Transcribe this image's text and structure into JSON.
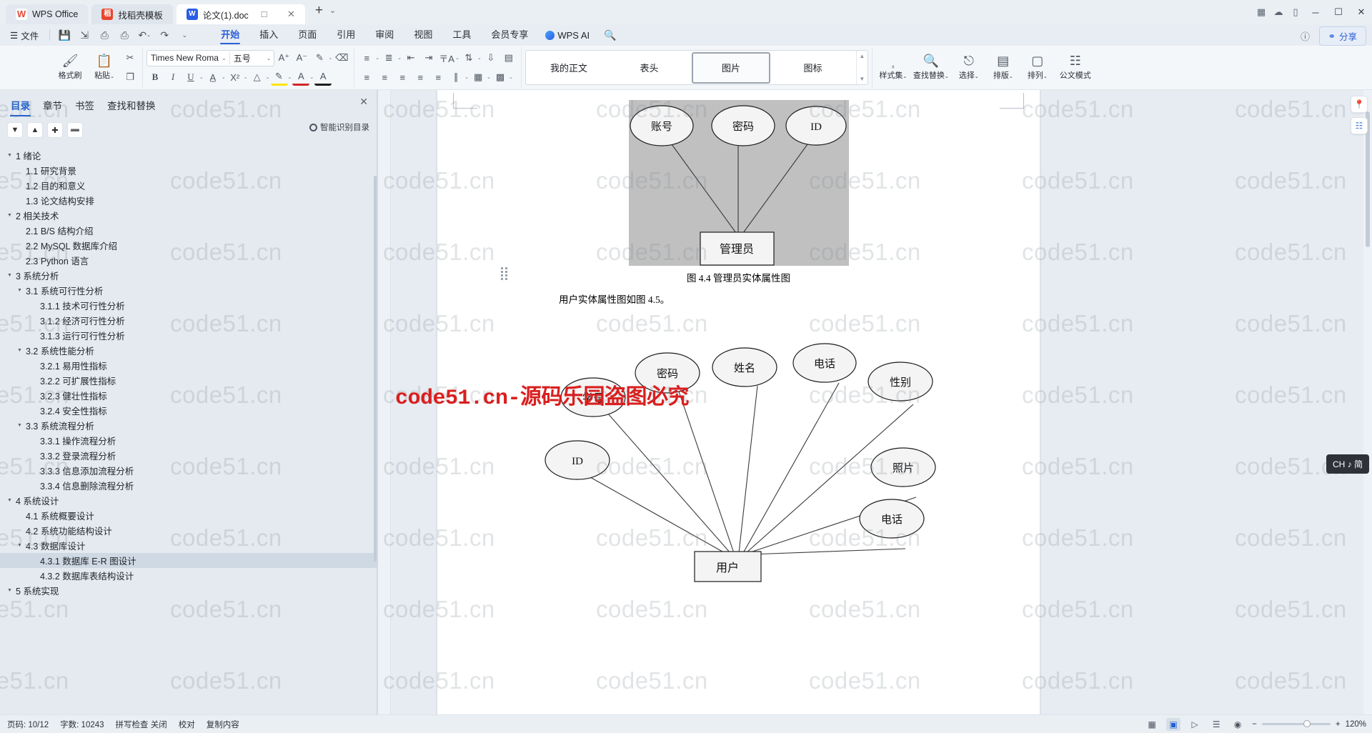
{
  "titlebar": {
    "tabs": [
      {
        "label": "WPS Office",
        "icon": "wps-logo-icon"
      },
      {
        "label": "找稻壳模板",
        "icon": "template-icon"
      },
      {
        "label": "论文(1).doc",
        "icon": "word-doc-icon"
      }
    ],
    "add_tab": "+",
    "chevron": "⌄",
    "window": {
      "minimize": "─",
      "maximize": "☐",
      "close": "✕"
    },
    "left_icons": [
      "grid-icon",
      "cloud-icon",
      "comment-icon"
    ]
  },
  "menurow": {
    "file_label": "文件",
    "quick_icons": [
      "save-icon",
      "save-as-icon",
      "print-icon",
      "print-preview-icon",
      "undo-icon",
      "redo-icon"
    ],
    "menus": [
      {
        "label": "开始",
        "active": true
      },
      {
        "label": "插入",
        "active": false
      },
      {
        "label": "页面",
        "active": false
      },
      {
        "label": "引用",
        "active": false
      },
      {
        "label": "审阅",
        "active": false
      },
      {
        "label": "视图",
        "active": false
      },
      {
        "label": "工具",
        "active": false
      },
      {
        "label": "会员专享",
        "active": false
      }
    ],
    "ai_label": "WPS AI",
    "search_icon": "search-icon",
    "share_label": "分享",
    "help_icon": "help-icon"
  },
  "ribbon": {
    "format_painter": {
      "label": "格式刷",
      "icon": "format-painter-icon"
    },
    "paste": {
      "label": "粘贴",
      "icon": "paste-icon"
    },
    "cut": {
      "icon": "scissors-icon"
    },
    "copy": {
      "icon": "copy-icon"
    },
    "font": {
      "name": "Times New Roma",
      "size": "五号"
    },
    "font_grow": "A⁺",
    "font_shrink": "A⁻",
    "styles": {
      "items": [
        {
          "label": "我的正文",
          "selected": false
        },
        {
          "label": "表头",
          "selected": false
        },
        {
          "label": "图片",
          "selected": true
        },
        {
          "label": "图标",
          "selected": false
        }
      ]
    },
    "right_buttons": [
      {
        "label": "样式集",
        "icon": "style-set-icon"
      },
      {
        "label": "查找替换",
        "icon": "find-replace-icon"
      },
      {
        "label": "选择",
        "icon": "select-icon"
      },
      {
        "label": "排版",
        "icon": "typeset-icon"
      },
      {
        "label": "排列",
        "icon": "arrange-icon"
      },
      {
        "label": "公文模式",
        "icon": "official-doc-icon"
      }
    ]
  },
  "sidebar": {
    "tabs": [
      {
        "label": "目录",
        "active": true
      },
      {
        "label": "章节",
        "active": false
      },
      {
        "label": "书签",
        "active": false
      },
      {
        "label": "查找和替换",
        "active": false
      }
    ],
    "close_icon": "close-icon",
    "tools": [
      "chevron-down-icon",
      "chevron-up-icon",
      "plus-icon",
      "minus-icon"
    ],
    "smart_toc_label": "智能识别目录",
    "toc": [
      {
        "level": 1,
        "num": "1",
        "text": "绪论",
        "expander": "▼",
        "selected": false
      },
      {
        "level": 2,
        "num": "1.1",
        "text": "研究背景",
        "expander": "",
        "selected": false
      },
      {
        "level": 2,
        "num": "1.2",
        "text": "目的和意义",
        "expander": "",
        "selected": false
      },
      {
        "level": 2,
        "num": "1.3",
        "text": "论文结构安排",
        "expander": "",
        "selected": false
      },
      {
        "level": 1,
        "num": "2",
        "text": "相关技术",
        "expander": "▼",
        "selected": false
      },
      {
        "level": 2,
        "num": "2.1",
        "text": "B/S 结构介绍",
        "expander": "",
        "selected": false
      },
      {
        "level": 2,
        "num": "2.2",
        "text": "MySQL 数据库介绍",
        "expander": "",
        "selected": false
      },
      {
        "level": 2,
        "num": "2.3",
        "text": "Python 语言",
        "expander": "",
        "selected": false
      },
      {
        "level": 1,
        "num": "3",
        "text": "系统分析",
        "expander": "▼",
        "selected": false
      },
      {
        "level": 2,
        "num": "3.1",
        "text": "系统可行性分析",
        "expander": "▼",
        "selected": false
      },
      {
        "level": 3,
        "num": "3.1.1",
        "text": "技术可行性分析",
        "expander": "",
        "selected": false
      },
      {
        "level": 3,
        "num": "3.1.2",
        "text": "经济可行性分析",
        "expander": "",
        "selected": false
      },
      {
        "level": 3,
        "num": "3.1.3",
        "text": "运行可行性分析",
        "expander": "",
        "selected": false
      },
      {
        "level": 2,
        "num": "3.2",
        "text": "系统性能分析",
        "expander": "▼",
        "selected": false
      },
      {
        "level": 3,
        "num": "3.2.1",
        "text": "易用性指标",
        "expander": "",
        "selected": false
      },
      {
        "level": 3,
        "num": "3.2.2",
        "text": "可扩展性指标",
        "expander": "",
        "selected": false
      },
      {
        "level": 3,
        "num": "3.2.3",
        "text": "健壮性指标",
        "expander": "",
        "selected": false
      },
      {
        "level": 3,
        "num": "3.2.4",
        "text": "安全性指标",
        "expander": "",
        "selected": false
      },
      {
        "level": 2,
        "num": "3.3",
        "text": "系统流程分析",
        "expander": "▼",
        "selected": false
      },
      {
        "level": 3,
        "num": "3.3.1",
        "text": "操作流程分析",
        "expander": "",
        "selected": false
      },
      {
        "level": 3,
        "num": "3.3.2",
        "text": "登录流程分析",
        "expander": "",
        "selected": false
      },
      {
        "level": 3,
        "num": "3.3.3",
        "text": "信息添加流程分析",
        "expander": "",
        "selected": false
      },
      {
        "level": 3,
        "num": "3.3.4",
        "text": "信息删除流程分析",
        "expander": "",
        "selected": false
      },
      {
        "level": 1,
        "num": "4",
        "text": "系统设计",
        "expander": "▼",
        "selected": false
      },
      {
        "level": 2,
        "num": "4.1",
        "text": "系统概要设计",
        "expander": "",
        "selected": false
      },
      {
        "level": 2,
        "num": "4.2",
        "text": "系统功能结构设计",
        "expander": "",
        "selected": false
      },
      {
        "level": 2,
        "num": "4.3",
        "text": "数据库设计",
        "expander": "▼",
        "selected": false
      },
      {
        "level": 3,
        "num": "4.3.1",
        "text": "数据库 E-R 图设计",
        "expander": "",
        "selected": true
      },
      {
        "level": 3,
        "num": "4.3.2",
        "text": "数据库表结构设计",
        "expander": "",
        "selected": false
      },
      {
        "level": 1,
        "num": "5",
        "text": "系统实现",
        "expander": "▼",
        "selected": false
      }
    ]
  },
  "document": {
    "figure1": {
      "entity": "管理员",
      "attributes": [
        "账号",
        "密码",
        "ID"
      ],
      "caption": "图 4.4 管理员实体属性图"
    },
    "paragraph": "用户实体属性图如图 4.5。",
    "figure2": {
      "entity": "用户",
      "attributes": [
        "学号",
        "密码",
        "姓名",
        "电话",
        "性别",
        "照片",
        "电话",
        "ID"
      ]
    }
  },
  "watermark": {
    "tile_text": "code51.cn",
    "red_text": "code51.cn-源码乐园盗图必究",
    "red_color": "#d91f1f"
  },
  "floating": {
    "buttons": [
      "location-pin-icon",
      "layers-icon"
    ],
    "ime_tip": "CH ♪ 简"
  },
  "status": {
    "page_info": "页码: 10/12",
    "word_count": "字数: 10243",
    "spell_check": "拼写检查 关闭",
    "doc_state": "校对",
    "edit_mode": "复制内容",
    "view_icons": [
      "web-layout-icon",
      "print-layout-icon",
      "reading-icon",
      "outline-icon",
      "focus-icon"
    ],
    "zoom_minus": "−",
    "zoom_plus": "+",
    "zoom_level": "120%"
  }
}
